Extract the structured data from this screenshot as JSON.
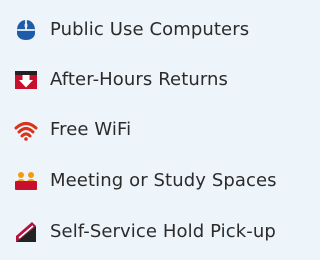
{
  "amenities": {
    "items": [
      {
        "label": "Public Use Computers",
        "icon": "mouse-icon",
        "color": "#1e5ba8"
      },
      {
        "label": "After-Hours Returns",
        "icon": "book-drop-icon",
        "color": "#c8102e"
      },
      {
        "label": "Free WiFi",
        "icon": "wifi-icon",
        "color": "#d9331a"
      },
      {
        "label": "Meeting or Study Spaces",
        "icon": "people-icon",
        "color": "#c8102e"
      },
      {
        "label": "Self-Service Hold Pick-up",
        "icon": "hold-pickup-icon",
        "color": "#b3123e"
      }
    ]
  }
}
